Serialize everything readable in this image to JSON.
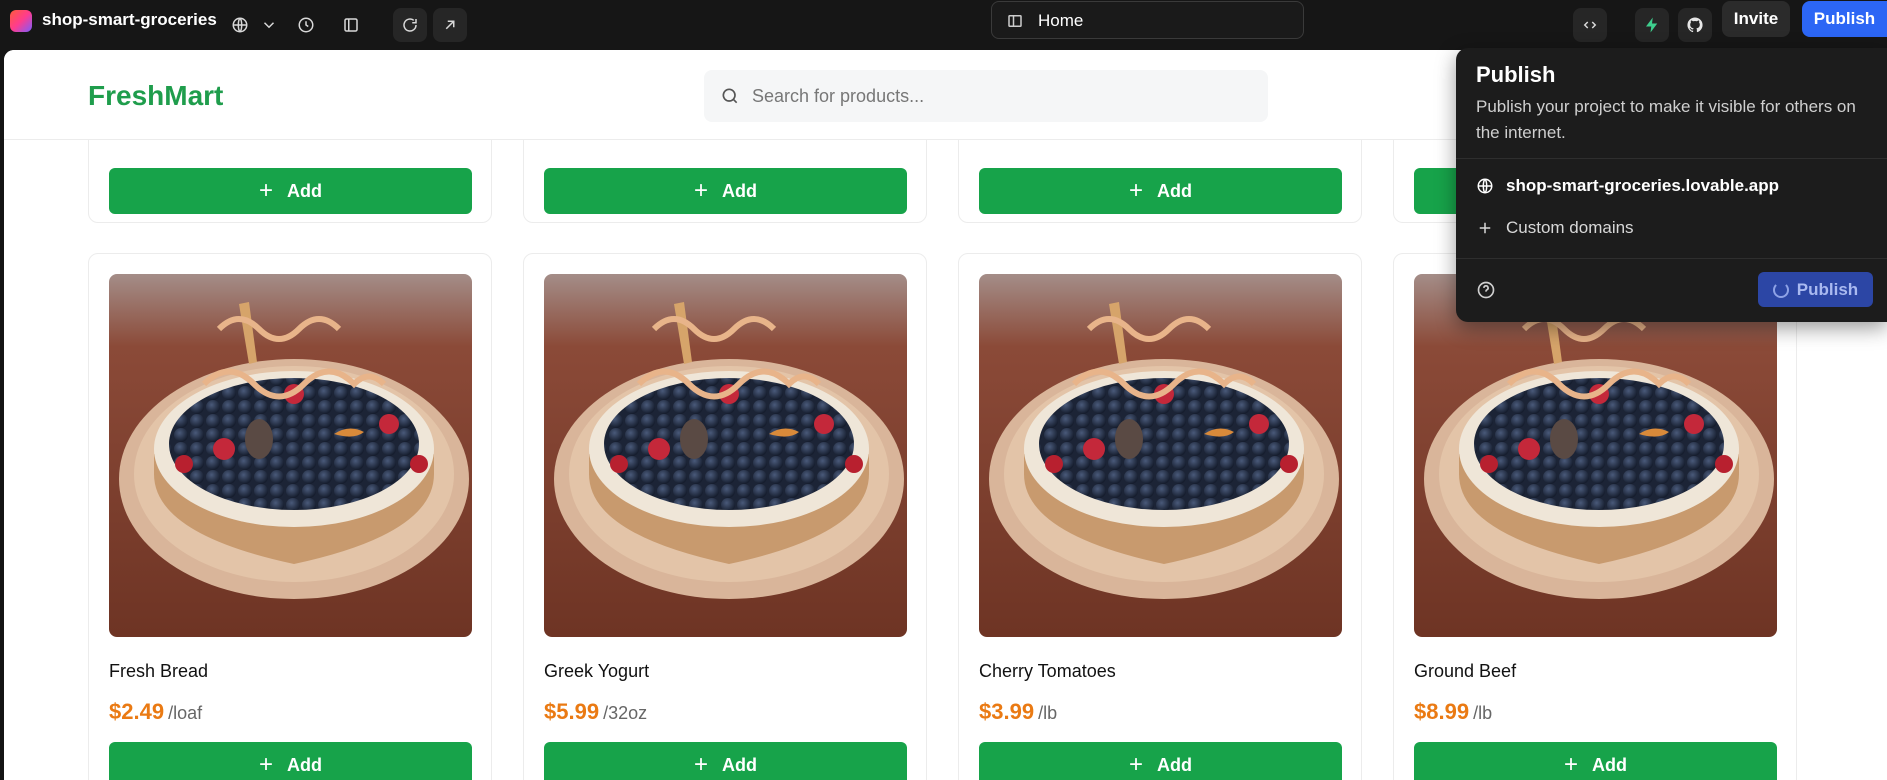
{
  "topbar": {
    "project_name": "shop-smart-groceries",
    "url_path": "Home",
    "invite_label": "Invite",
    "publish_label": "Publish",
    "icons": [
      "globe-icon",
      "chevron-down-icon",
      "history-icon",
      "sidebar-toggle-icon",
      "refresh-icon",
      "open-external-icon",
      "code-icon",
      "supabase-icon",
      "github-icon"
    ]
  },
  "site": {
    "brand": "FreshMart",
    "search_placeholder": "Search for products...",
    "add_label": "Add",
    "products": [
      {
        "name": "Fresh Bread",
        "price": "$2.49",
        "unit": "/loaf"
      },
      {
        "name": "Greek Yogurt",
        "price": "$5.99",
        "unit": "/32oz"
      },
      {
        "name": "Cherry Tomatoes",
        "price": "$3.99",
        "unit": "/lb"
      },
      {
        "name": "Ground Beef",
        "price": "$8.99",
        "unit": "/lb"
      }
    ]
  },
  "publish_panel": {
    "title": "Publish",
    "description": "Publish your project to make it visible for others on the internet.",
    "domain": "shop-smart-groceries.lovable.app",
    "custom_domains_label": "Custom domains",
    "publish_button_label": "Publish",
    "publish_in_progress": true
  },
  "colors": {
    "brand_green": "#1f9d4c",
    "button_green": "#17a34a",
    "price_orange": "#ea7a13",
    "publish_blue": "#2c66f5"
  }
}
